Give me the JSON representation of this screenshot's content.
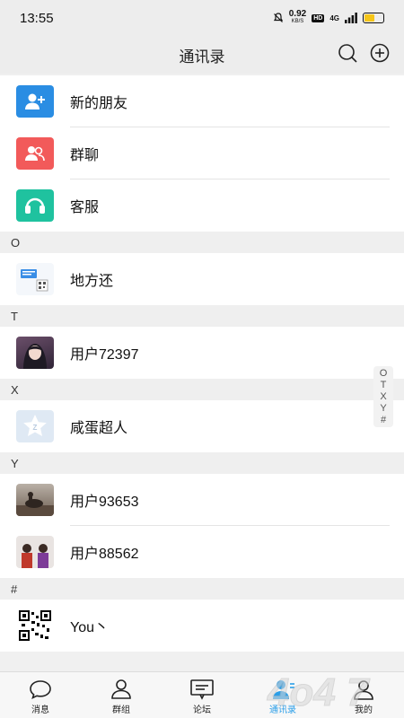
{
  "status": {
    "time": "13:55",
    "speed_value": "0.92",
    "speed_unit": "KB/S",
    "hd": "HD",
    "network": "4G"
  },
  "header": {
    "title": "通讯录"
  },
  "entries_top": [
    {
      "label": "新的朋友",
      "icon": "add-friend-icon",
      "color": "#2a8de3"
    },
    {
      "label": "群聊",
      "icon": "group-chat-icon",
      "color": "#f25a5a"
    },
    {
      "label": "客服",
      "icon": "headset-icon",
      "color": "#1fc29f"
    }
  ],
  "sections": [
    {
      "letter": "O",
      "contacts": [
        "地方还"
      ]
    },
    {
      "letter": "T",
      "contacts": [
        "用户72397"
      ]
    },
    {
      "letter": "X",
      "contacts": [
        "咸蛋超人"
      ]
    },
    {
      "letter": "Y",
      "contacts": [
        "用户93653",
        "用户88562"
      ]
    },
    {
      "letter": "#",
      "contacts": [
        "You丶"
      ]
    }
  ],
  "index": [
    "O",
    "T",
    "X",
    "Y",
    "#"
  ],
  "tabs": [
    {
      "label": "消息",
      "icon": "message-icon"
    },
    {
      "label": "群组",
      "icon": "group-icon"
    },
    {
      "label": "论坛",
      "icon": "forum-icon"
    },
    {
      "label": "通讯录",
      "icon": "contacts-icon",
      "active": true
    },
    {
      "label": "我的",
      "icon": "profile-icon"
    }
  ],
  "colors": {
    "accent": "#2a9ee8",
    "background": "#f0f0f0"
  }
}
